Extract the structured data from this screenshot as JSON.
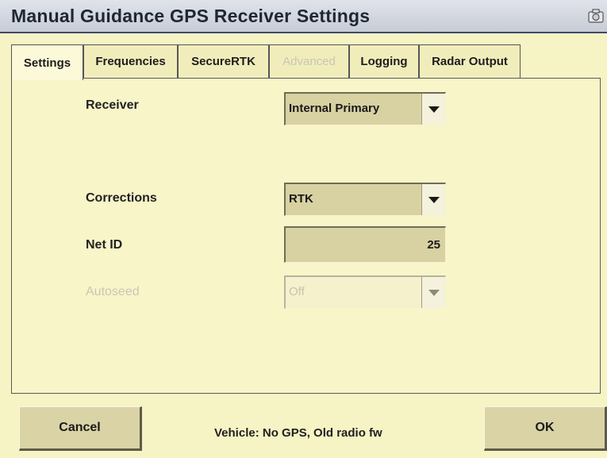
{
  "window": {
    "title": "Manual Guidance GPS Receiver Settings",
    "camera_icon": "camera-icon"
  },
  "tabs": [
    {
      "label": "Settings",
      "state": "active"
    },
    {
      "label": "Frequencies",
      "state": "normal"
    },
    {
      "label": "SecureRTK",
      "state": "normal"
    },
    {
      "label": "Advanced",
      "state": "disabled"
    },
    {
      "label": "Logging",
      "state": "normal"
    },
    {
      "label": "Radar Output",
      "state": "normal"
    }
  ],
  "form": {
    "receiver": {
      "label": "Receiver",
      "value": "Internal Primary"
    },
    "corrections": {
      "label": "Corrections",
      "value": "RTK"
    },
    "net_id": {
      "label": "Net ID",
      "value": "25"
    },
    "autoseed": {
      "label": "Autoseed",
      "value": "Off",
      "state": "disabled"
    }
  },
  "footer": {
    "cancel_label": "Cancel",
    "status_text": "Vehicle: No GPS, Old radio fw",
    "ok_label": "OK"
  },
  "colors": {
    "background": "#f6f3c4",
    "field_fill": "#d8d1a2",
    "title_bar": "#c7ccd6"
  }
}
